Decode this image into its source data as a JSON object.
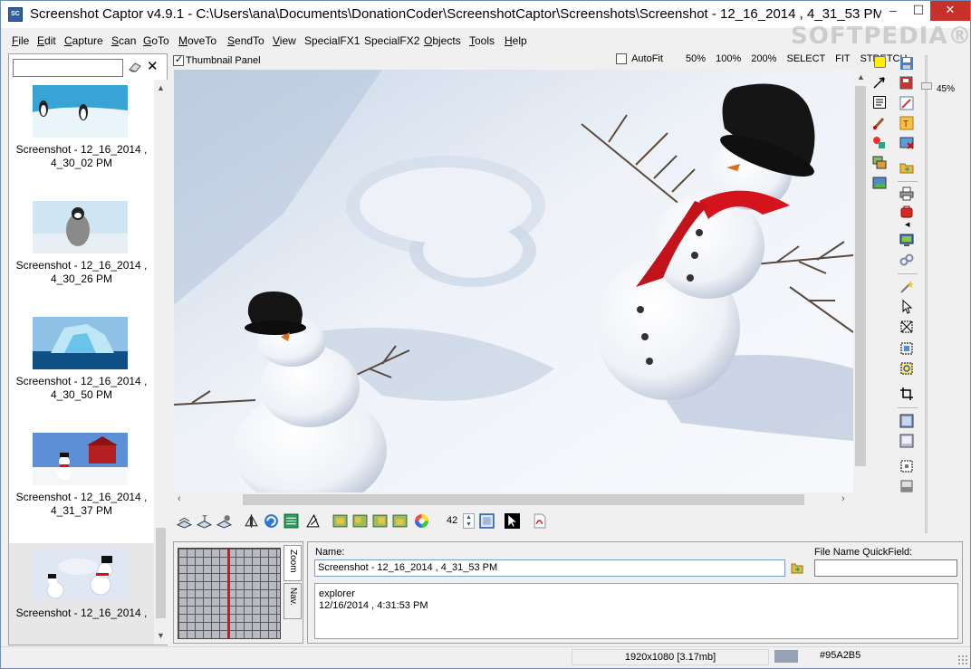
{
  "window": {
    "title": "Screenshot Captor v4.9.1 - C:\\Users\\ana\\Documents\\DonationCoder\\ScreenshotCaptor\\Screenshots\\Screenshot - 12_16_2014 , 4_31_53 PM.p...",
    "watermark": "SOFTPEDIA®",
    "controls": {
      "minimize": "–",
      "maximize": "☐",
      "close": "✕"
    }
  },
  "menu": [
    {
      "label": "File",
      "u": "F",
      "rest": "ile"
    },
    {
      "label": "Edit",
      "u": "E",
      "rest": "dit"
    },
    {
      "label": "Capture",
      "u": "C",
      "rest": "apture"
    },
    {
      "label": "Scan",
      "u": "S",
      "rest": "can"
    },
    {
      "label": "GoTo",
      "u": "G",
      "rest": "oTo"
    },
    {
      "label": "MoveTo",
      "u": "M",
      "rest": "oveTo"
    },
    {
      "label": "SendTo",
      "u": "S",
      "rest": "endTo"
    },
    {
      "label": "View",
      "u": "V",
      "rest": "iew"
    },
    {
      "label": "SpecialFX1",
      "u": "",
      "rest": "SpecialFX1"
    },
    {
      "label": "SpecialFX2",
      "u": "",
      "rest": "SpecialFX2"
    },
    {
      "label": "Objects",
      "u": "O",
      "rest": "bjects"
    },
    {
      "label": "Tools",
      "u": "T",
      "rest": "ools"
    },
    {
      "label": "Help",
      "u": "H",
      "rest": "elp"
    }
  ],
  "thumbnails": {
    "filter_value": "",
    "items": [
      {
        "line1": "Screenshot - 12_16_2014 ,",
        "line2": "4_30_02 PM",
        "scene": "penguins-ice"
      },
      {
        "line1": "Screenshot - 12_16_2014 ,",
        "line2": "4_30_26 PM",
        "scene": "penguin-chick"
      },
      {
        "line1": "Screenshot - 12_16_2014 ,",
        "line2": "4_30_50 PM",
        "scene": "iceberg"
      },
      {
        "line1": "Screenshot - 12_16_2014 ,",
        "line2": "4_31_37 PM",
        "scene": "snowman-barn"
      },
      {
        "line1": "Screenshot - 12_16_2014 ,",
        "line2": "",
        "scene": "snowmen",
        "selected": true
      }
    ]
  },
  "view_options": {
    "thumbnail_panel_label": "Thumbnail Panel",
    "thumbnail_panel_checked": true,
    "autofit_label": "AutoFit",
    "autofit_checked": false,
    "zoom_options": [
      "50%",
      "100%",
      "200%",
      "SELECT",
      "FIT",
      "STRETCH"
    ]
  },
  "zoom_level": "45%",
  "toolbar_number": "42",
  "nav_tabs": [
    "Zoom",
    "Nav."
  ],
  "info": {
    "name_label": "Name:",
    "name_value": "Screenshot - 12_16_2014 , 4_31_53 PM",
    "quickfield_label": "File Name QuickField:",
    "quickfield_value": "",
    "notes_line1": "explorer",
    "notes_line2": "12/16/2014 , 4:31:53 PM"
  },
  "status": {
    "dimensions": "1920x1080  [3.17mb]",
    "color_hex": "#95A2B5",
    "swatch": "#95A2B5"
  },
  "colors": {
    "close_button": "#c7312a",
    "nav_red_line": "#e0121a"
  }
}
